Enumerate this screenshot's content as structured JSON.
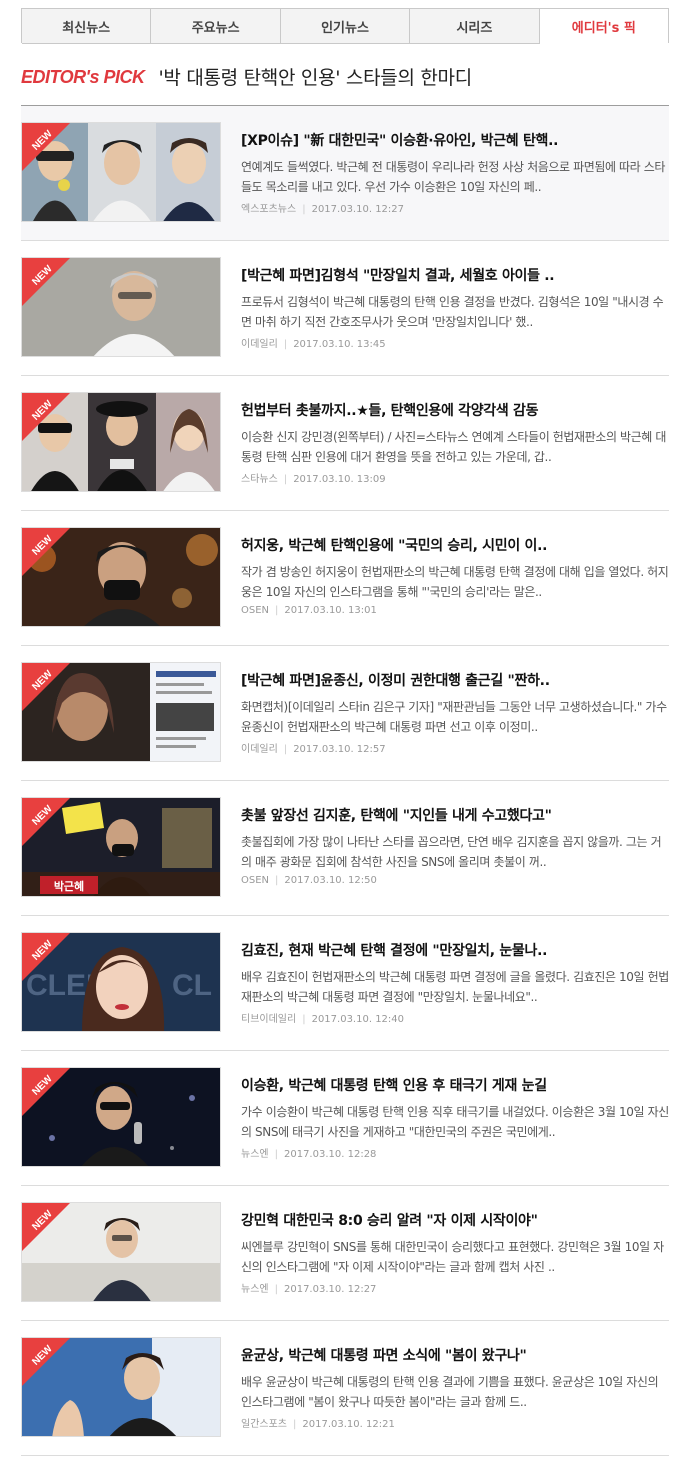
{
  "tabs": [
    {
      "label": "최신뉴스",
      "active": false
    },
    {
      "label": "주요뉴스",
      "active": false
    },
    {
      "label": "인기뉴스",
      "active": false
    },
    {
      "label": "시리즈",
      "active": false
    },
    {
      "label": "에디터's 픽",
      "active": true
    }
  ],
  "header": {
    "logo_main": "EDITOR's PICK",
    "title": "'박 대통령 탄핵안 인용' 스타들의 한마디"
  },
  "badge_text": "NEW",
  "articles": [
    {
      "headline": "[XP이슈] \"新 대한민국\" 이승환·유아인, 박근혜 탄핵..",
      "summary": "연예계도 들썩였다. 박근혜 전 대통령이 우리나라 헌정 사상 처음으로 파면됨에 따라 스타들도 목소리를 내고 있다. 우선 가수 이승환은 10일 자신의 페..",
      "source": "엑스포츠뉴스",
      "time": "2017.03.10. 12:27"
    },
    {
      "headline": "[박근혜 파면]김형석 \"만장일치 결과, 세월호 아이들 ..",
      "summary": "프로듀서 김형석이 박근혜 대통령의 탄핵 인용 결정을 반겼다. 김형석은 10일 \"내시경 수면 마취 하기 직전 간호조무사가 웃으며 '만장일치입니다' 했..",
      "source": "이데일리",
      "time": "2017.03.10. 13:45"
    },
    {
      "headline": "헌법부터 촛불까지..★들, 탄핵인용에 각양각색 감동",
      "summary": "이승환 신지 강민경(왼쪽부터) / 사진=스타뉴스 연예계 스타들이 헌법재판소의 박근혜 대통령 탄핵 심판 인용에 대거 환영을 뜻을 전하고 있는 가운데, 갑..",
      "source": "스타뉴스",
      "time": "2017.03.10. 13:09"
    },
    {
      "headline": "허지웅, 박근혜 탄핵인용에 \"국민의 승리, 시민이 이..",
      "summary": "작가 겸 방송인 허지웅이 헌법재판소의 박근혜 대통령 탄핵 결정에 대해 입을 열었다. 허지웅은 10일 자신의 인스타그램을 통해 \"'국민의 승리'라는 말은..",
      "source": "OSEN",
      "time": "2017.03.10. 13:01"
    },
    {
      "headline": "[박근혜 파면]윤종신, 이정미 권한대행 출근길 \"짠하..",
      "summary": "화면캡처)[이데일리 스타in 김은구 기자] \"재판관님들 그동안 너무 고생하셨습니다.\" 가수 윤종신이 헌법재판소의 박근혜 대통령 파면 선고 이후 이정미..",
      "source": "이데일리",
      "time": "2017.03.10. 12:57"
    },
    {
      "headline": "촛불 앞장선 김지훈, 탄핵에 \"지인들 내게 수고했다고\"",
      "summary": " 촛불집회에 가장 많이 나타난 스타를 꼽으라면, 단연 배우 김지훈을 꼽지 않을까. 그는 거의 매주 광화문 집회에 참석한 사진을 SNS에 올리며 촛불이 꺼..",
      "source": "OSEN",
      "time": "2017.03.10. 12:50"
    },
    {
      "headline": "김효진, 현재 박근혜 탄핵 결정에 \"만장일치, 눈물나..",
      "summary": "배우 김효진이 헌법재판소의 박근혜 대통령 파면 결정에 글을 올렸다. 김효진은 10일 헌법재판소의 박근혜 대통령 파면 결정에 \"만장일치. 눈물나네요\"..",
      "source": "티브이데일리",
      "time": "2017.03.10. 12:40"
    },
    {
      "headline": "이승환, 박근혜 대통령 탄핵 인용 후 태극기 게재 눈길",
      "summary": "가수 이승환이 박근혜 대통령 탄핵 인용 직후 태극기를 내걸었다. 이승환은 3월 10일 자신의 SNS에 태극기 사진을 게재하고 \"대한민국의 주권은 국민에게..",
      "source": "뉴스엔",
      "time": "2017.03.10. 12:28"
    },
    {
      "headline": "강민혁 대한민국 8:0 승리 알려 \"자 이제 시작이야\"",
      "summary": "씨엔블루 강민혁이 SNS를 통해 대한민국이 승리했다고 표현했다. 강민혁은 3월 10일 자신의 인스타그램에 \"자 이제 시작이야\"라는 글과 함께 캡처 사진 ..",
      "source": "뉴스엔",
      "time": "2017.03.10. 12:27"
    },
    {
      "headline": "윤균상, 박근혜 대통령 파면 소식에 \"봄이 왔구나\"",
      "summary": "배우 윤균상이 박근혜 대통령의 탄핵 인용 결과에 기쁨을 표했다. 윤균상은 10일 자신의 인스타그램에 \"봄이 왔구나 따듯한 봄이\"라는 글과 함께 드..",
      "source": "일간스포츠",
      "time": "2017.03.10. 12:21"
    }
  ],
  "thumb_overlay_text": "박근혜",
  "colors": {
    "accent": "#e0393e",
    "badge": "#e8403f"
  }
}
